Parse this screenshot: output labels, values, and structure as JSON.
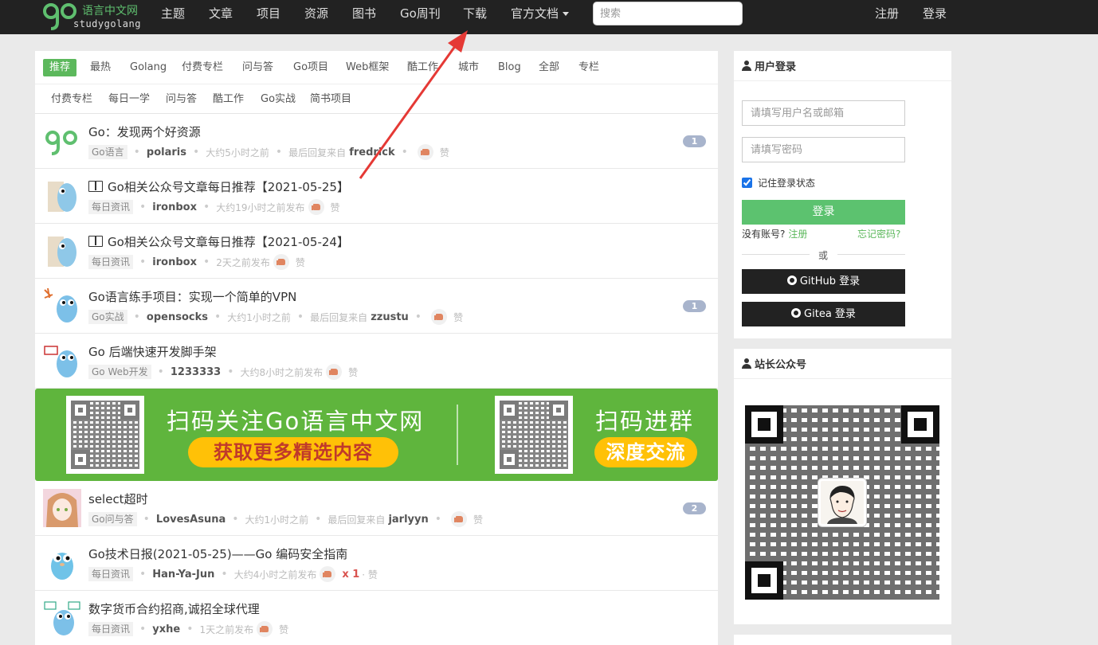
{
  "navbar": {
    "logo_cn": "语言中文网",
    "logo_en": "studygolang",
    "items": [
      "主题",
      "文章",
      "项目",
      "资源",
      "图书",
      "Go周刊",
      "下载",
      "官方文档"
    ],
    "search_placeholder": "搜索",
    "register": "注册",
    "login": "登录"
  },
  "tabs_row1": [
    "推荐",
    "最热",
    "Golang",
    "付费专栏",
    "问与答",
    "Go项目",
    "Web框架",
    "酷工作",
    "城市",
    "Blog",
    "全部",
    "专栏"
  ],
  "tabs_row2": [
    "付费专栏",
    "每日一学",
    "问与答",
    "酷工作",
    "Go实战",
    "简书项目"
  ],
  "topics": [
    {
      "title": "Go：发现两个好资源",
      "node": "Go语言",
      "author": "polaris",
      "time": "大约5小时之前",
      "last_label": "最后回复来自",
      "last_user": "fredrick",
      "zan": "赞",
      "replies": "1",
      "book": false
    },
    {
      "title": "Go相关公众号文章每日推荐【2021-05-25】",
      "node": "每日资讯",
      "author": "ironbox",
      "time": "大约19小时之前发布",
      "zan": "赞",
      "book": true
    },
    {
      "title": "Go相关公众号文章每日推荐【2021-05-24】",
      "node": "每日资讯",
      "author": "ironbox",
      "time": "2天之前发布",
      "zan": "赞",
      "book": true
    },
    {
      "title": "Go语言练手项目：实现一个简单的VPN",
      "node": "Go实战",
      "author": "opensocks",
      "time": "大约1小时之前",
      "last_label": "最后回复来自",
      "last_user": "zzustu",
      "zan": "赞",
      "replies": "1",
      "book": false
    },
    {
      "title": "Go 后端快速开发脚手架",
      "node": "Go Web开发",
      "author": "1233333",
      "time": "大约8小时之前发布",
      "zan": "赞",
      "book": false
    },
    {
      "title": "select超时",
      "node": "Go问与答",
      "author": "LovesAsuna",
      "time": "大约1小时之前",
      "last_label": "最后回复来自",
      "last_user": "jarlyyn",
      "zan": "赞",
      "replies": "2",
      "book": false
    },
    {
      "title": "Go技术日报(2021-05-25)——Go 编码安全指南",
      "node": "每日资讯",
      "author": "Han-Ya-Jun",
      "time": "大约4小时之前发布",
      "likes": "x 1",
      "zan": "· 赞",
      "book": false
    },
    {
      "title": "数字货币合约招商,诚招全球代理",
      "node": "每日资讯",
      "author": "yxhe",
      "time": "1天之前发布",
      "zan": "赞",
      "book": false
    }
  ],
  "banner": {
    "text1": "扫码关注Go语言中文网",
    "pill1": "获取更多精选内容",
    "text2": "扫码进群",
    "pill2": "深度交流"
  },
  "login_box": {
    "title": "用户登录",
    "user_placeholder": "请填写用户名或邮箱",
    "pass_placeholder": "请填写密码",
    "remember": "记住登录状态",
    "login_btn": "登录",
    "no_account": "没有账号?",
    "register": "注册",
    "forgot": "忘记密码?",
    "or": "或",
    "github": "GitHub 登录",
    "gitea": "Gitea 登录"
  },
  "wechat_box": {
    "title": "站长公众号"
  },
  "colors": {
    "navbar_bg": "#222222",
    "accent_green": "#5cb85c",
    "banner_green": "#5fb53d",
    "pill_yellow": "#ffc107",
    "arrow_red": "#e53935"
  }
}
